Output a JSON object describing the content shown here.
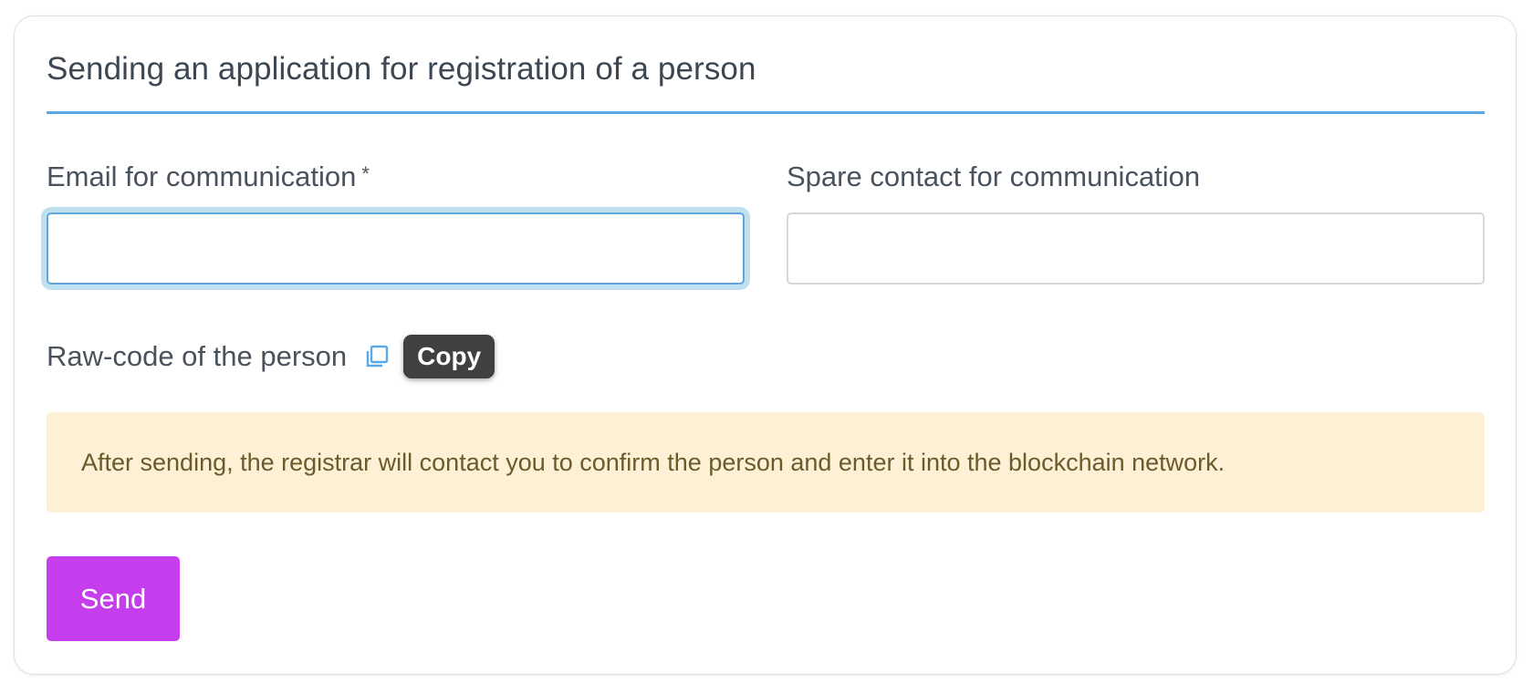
{
  "form": {
    "title": "Sending an application for registration of a person",
    "email_field": {
      "label": "Email for communication",
      "required_mark": "*",
      "value": "",
      "placeholder": ""
    },
    "spare_field": {
      "label": "Spare contact for communication",
      "value": "",
      "placeholder": ""
    },
    "raw_code": {
      "label": "Raw-code of the person",
      "copy_icon": "copy-icon",
      "tooltip": "Copy"
    },
    "notice": "After sending, the registrar will contact you to confirm the person and enter it into the blockchain network.",
    "send_label": "Send"
  },
  "colors": {
    "accent_rule": "#5aa9e6",
    "focus_ring": "#bfe0ef",
    "notice_bg": "#fcf1d4",
    "send_button": "#c63ded",
    "tooltip_bg": "#3f4041"
  }
}
